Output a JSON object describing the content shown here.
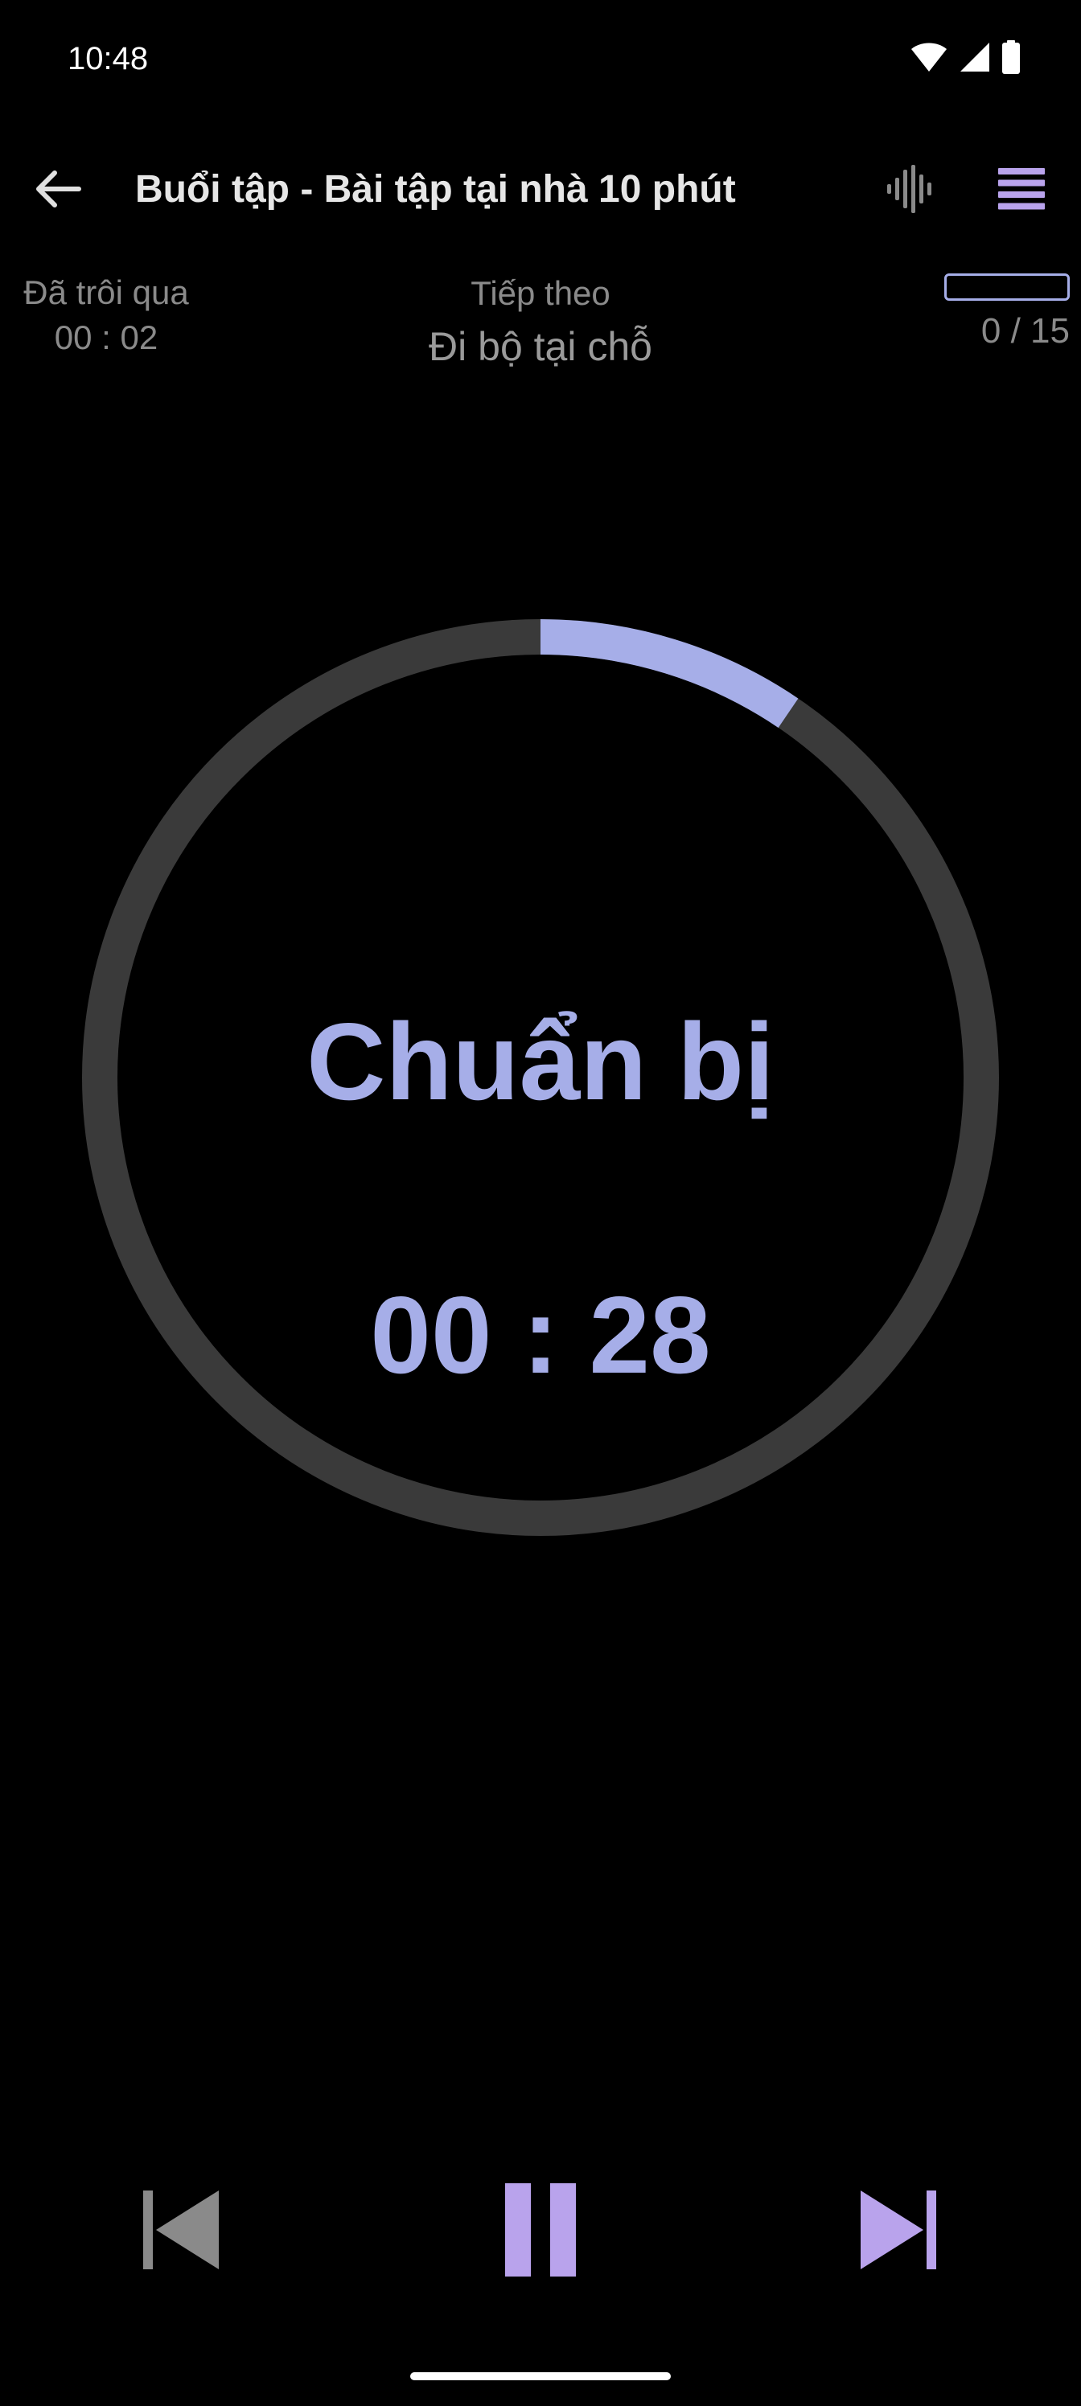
{
  "status_bar": {
    "time": "10:48",
    "icons": [
      "wifi-icon",
      "signal-icon",
      "battery-icon"
    ]
  },
  "toolbar": {
    "title": "Buổi tập - Bài tập tại nhà 10 phút",
    "back_icon": "arrow-left-icon",
    "sound_icon": "waveform-icon",
    "list_icon": "list-icon"
  },
  "info": {
    "elapsed_label": "Đã trôi qua",
    "elapsed_value": "00 : 02",
    "next_label": "Tiếp theo",
    "next_exercise": "Đi bộ tại chỗ",
    "progress_text": "0 / 15",
    "progress_fraction": 0
  },
  "timer": {
    "phase": "Chuẩn bị",
    "countdown": "00 : 28",
    "ring_progress": 0.095
  },
  "controls": {
    "prev_icon": "skip-previous-icon",
    "pause_icon": "pause-icon",
    "next_icon": "skip-next-icon"
  },
  "colors": {
    "background": "#000000",
    "accent": "#a6aee8",
    "button_accent": "#b9a3ec",
    "track": "#3a3a3a",
    "muted_text": "#8a8a8a"
  }
}
